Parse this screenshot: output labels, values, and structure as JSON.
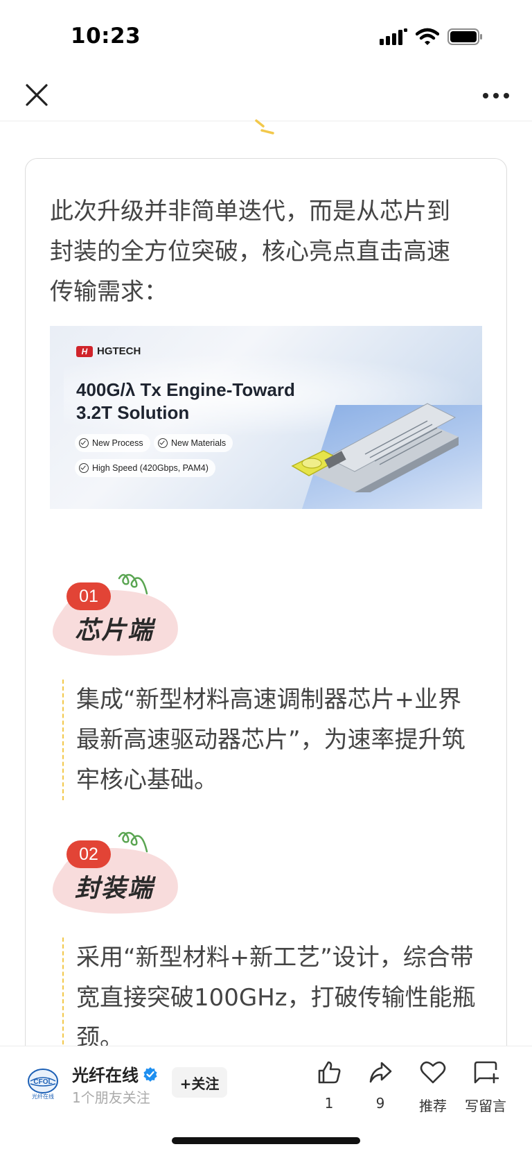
{
  "status_bar": {
    "time": "10:23"
  },
  "article": {
    "intro": "此次升级并非简单迭代，而是从芯片到封装的全方位突破，核心亮点直击高速传输需求：",
    "banner": {
      "brand": "HGTECH",
      "title_line1": "400G/λ Tx Engine-Toward",
      "title_line2": "3.2T Solution",
      "pills": [
        "New Process",
        "New Materials",
        "High Speed (420Gbps, PAM4)"
      ]
    },
    "sections": [
      {
        "number": "01",
        "title": "芯片端",
        "body": "集成“新型材料高速调制器芯片+业界最新高速驱动器芯片”，为速率提升筑牢核心基础。"
      },
      {
        "number": "02",
        "title": "封装端",
        "body": "采用“新型材料+新工艺”设计，综合带宽直接突破100GHz，打破传输性能瓶颈。"
      }
    ]
  },
  "bottom_bar": {
    "account_name": "光纤在线",
    "account_sub": "1个朋友关注",
    "logo_text": "CFOL",
    "logo_caption": "光纤在线",
    "follow_label": "+关注",
    "actions": [
      {
        "icon": "thumbs-up-icon",
        "label": "1"
      },
      {
        "icon": "share-icon",
        "label": "9"
      },
      {
        "icon": "heart-icon",
        "label": "推荐"
      },
      {
        "icon": "comment-icon",
        "label": "写留言"
      }
    ]
  },
  "colors": {
    "accent_red": "#e24436",
    "dash_yellow": "#f2c84b",
    "verified_blue": "#1e8ff0",
    "vine_green": "#5aa552"
  }
}
